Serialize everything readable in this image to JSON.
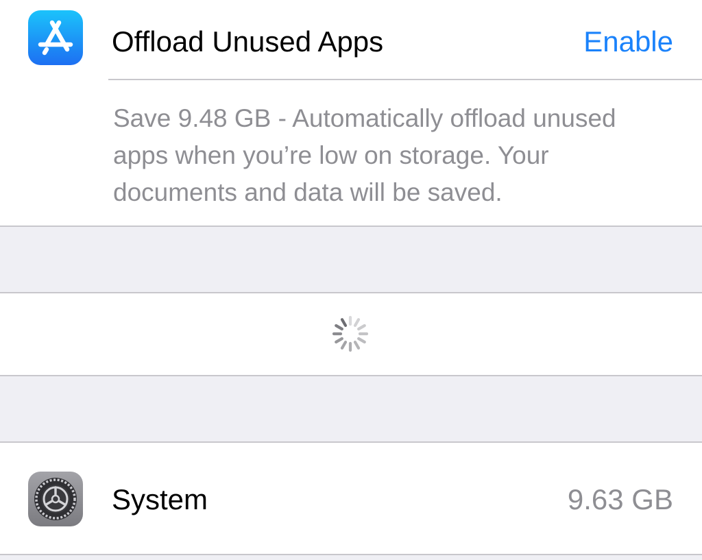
{
  "offload": {
    "title": "Offload Unused Apps",
    "action_label": "Enable",
    "description": "Save 9.48 GB - Automatically offload unused apps when you’re low on storage. Your documents and data will be saved.",
    "icon": "app-store-icon"
  },
  "loading": {
    "icon": "activity-spinner-icon"
  },
  "system": {
    "title": "System",
    "size": "9.63 GB",
    "icon": "settings-gear-icon"
  },
  "colors": {
    "accent": "#1a82fb",
    "secondary_text": "#8e8e93",
    "group_background": "#efeff4",
    "separator": "#c8c7cc"
  }
}
